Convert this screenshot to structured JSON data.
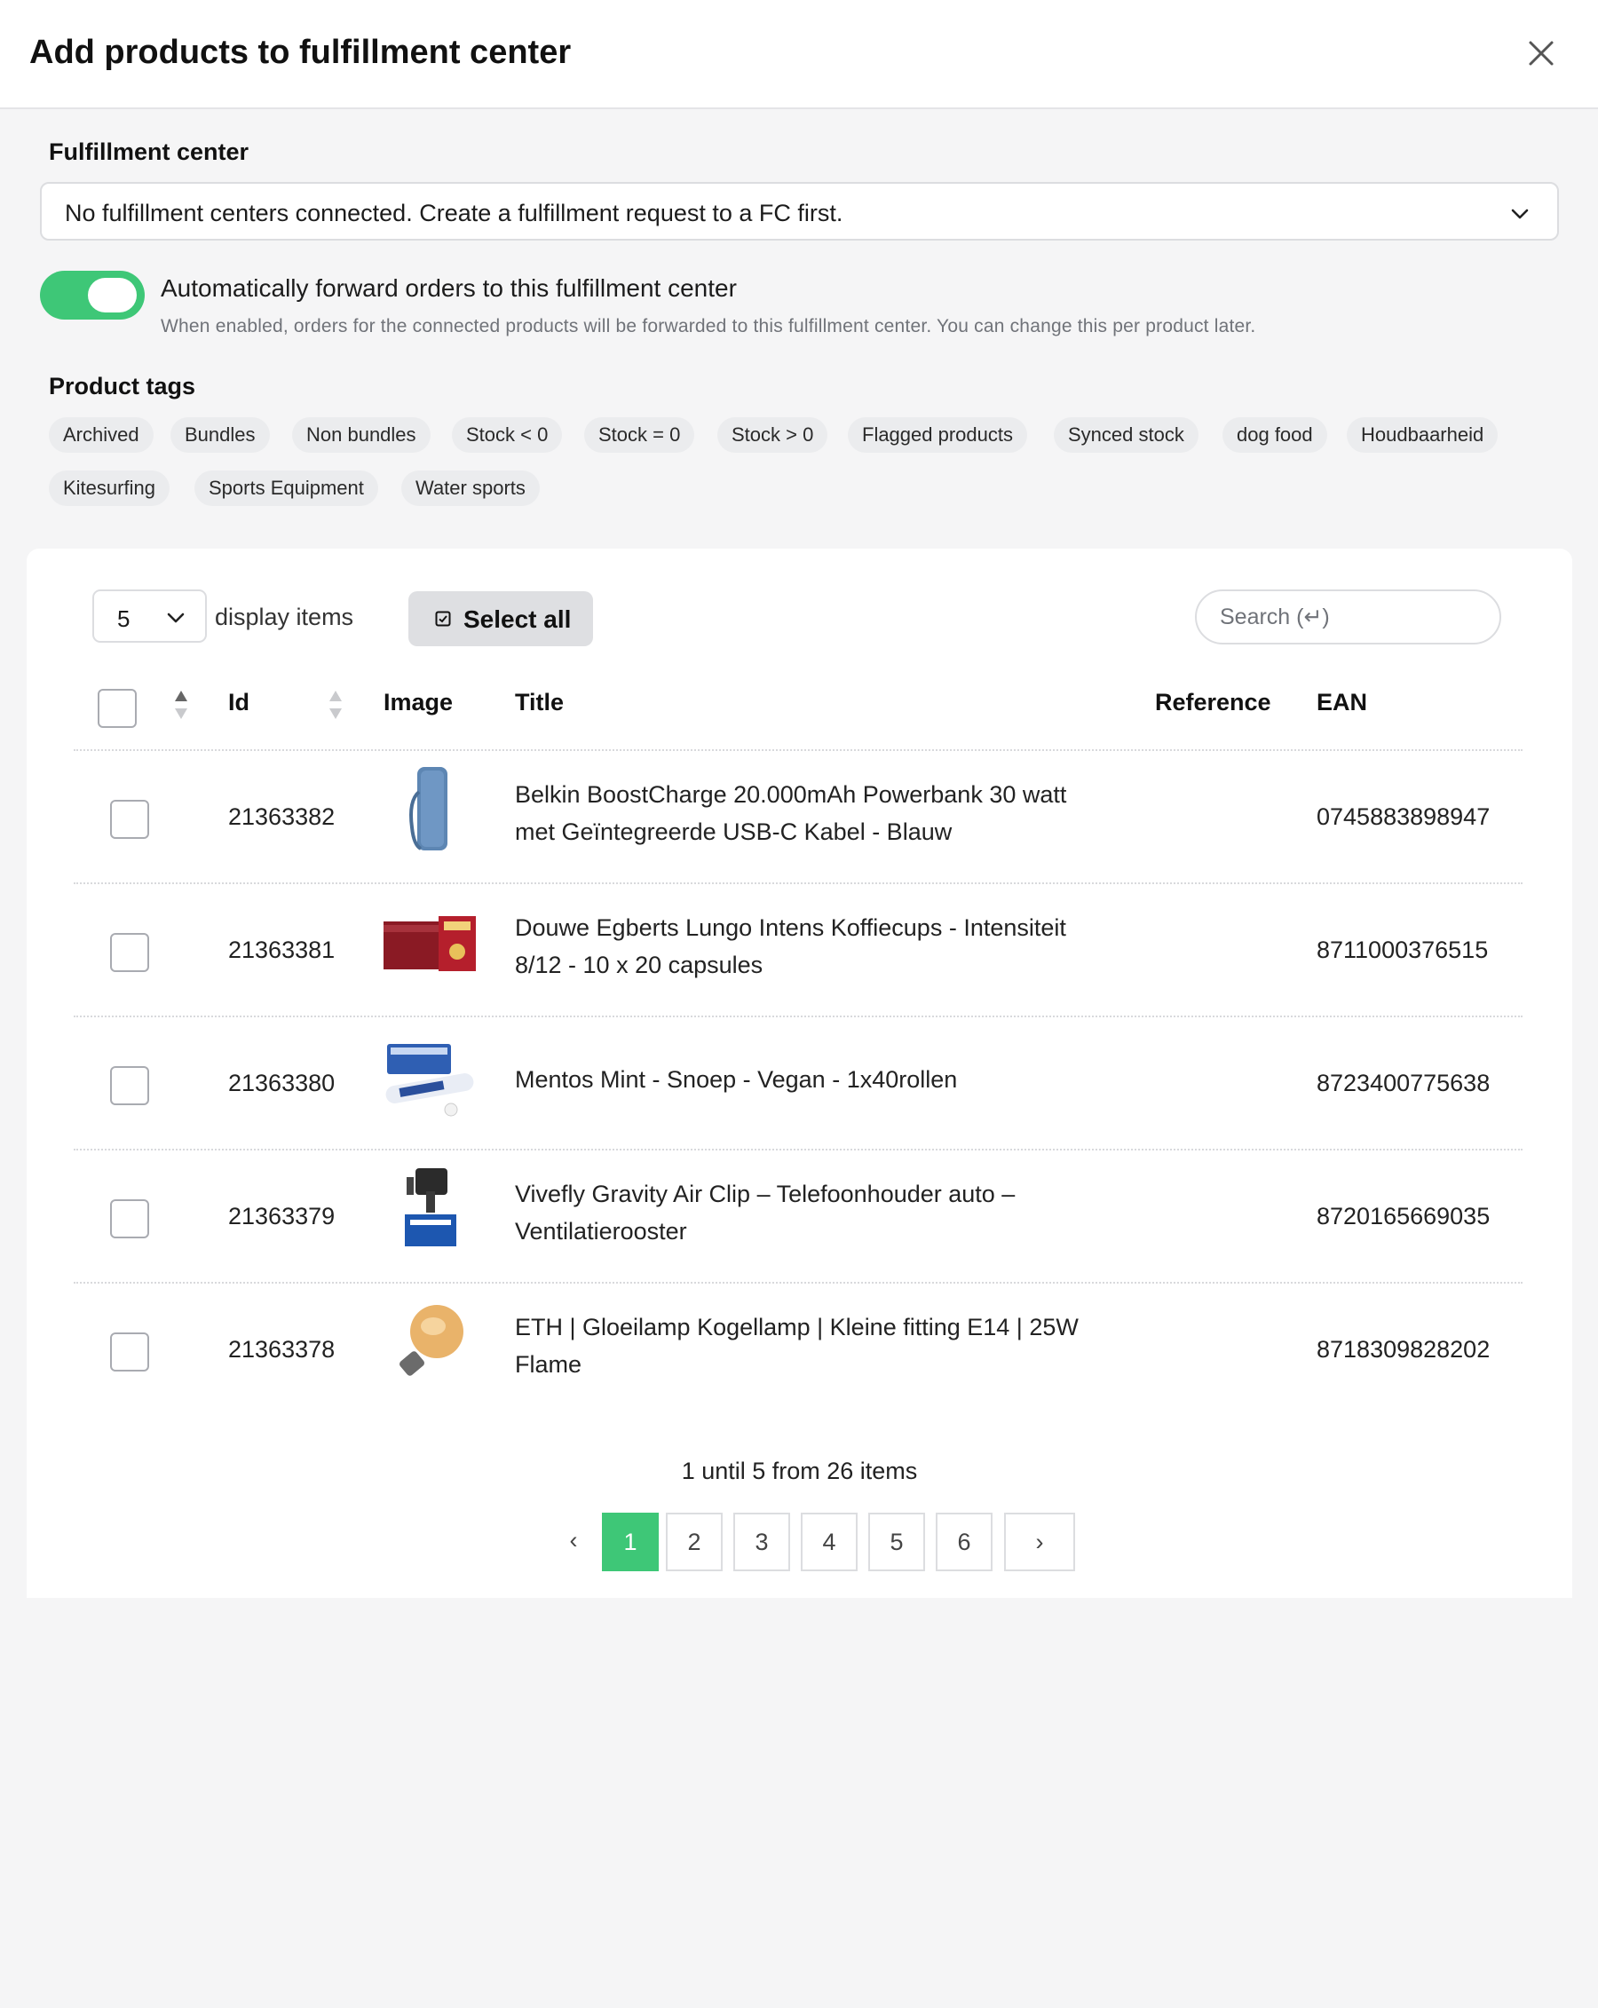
{
  "dialog": {
    "title": "Add products to fulfillment center"
  },
  "fulfillment": {
    "label": "Fulfillment center",
    "selected": "No fulfillment centers connected. Create a fulfillment request to a FC first."
  },
  "forward": {
    "enabled": true,
    "label": "Automatically forward orders to this fulfillment center",
    "help": "When enabled, orders for the connected products will be forwarded to this fulfillment center. You can change this per product later."
  },
  "tags": {
    "label": "Product tags",
    "items": [
      "Archived",
      "Bundles",
      "Non bundles",
      "Stock < 0",
      "Stock = 0",
      "Stock > 0",
      "Flagged products",
      "Synced stock",
      "dog food",
      "Houdbaarheid",
      "Kitesurfing",
      "Sports Equipment",
      "Water sports"
    ]
  },
  "table_controls": {
    "per_page": "5",
    "display_label": "display items",
    "select_all": "Select all",
    "search_placeholder": "Search (↵)"
  },
  "columns": {
    "id": "Id",
    "image": "Image",
    "title": "Title",
    "reference": "Reference",
    "ean": "EAN"
  },
  "rows": [
    {
      "id": "21363382",
      "title_line1": "Belkin BoostCharge 20.000mAh Powerbank 30 watt",
      "title_line2": "met Geïntegreerde USB-C Kabel - Blauw",
      "reference": "",
      "ean": "0745883898947",
      "image": "powerbank"
    },
    {
      "id": "21363381",
      "title_line1": "Douwe Egberts Lungo Intens Koffiecups - Intensiteit",
      "title_line2": "8/12 - 10 x 20 capsules",
      "reference": "",
      "ean": "8711000376515",
      "image": "coffee-boxes"
    },
    {
      "id": "21363380",
      "title_line1": "Mentos Mint - Snoep - Vegan - 1x40rollen",
      "title_line2": "",
      "reference": "",
      "ean": "8723400775638",
      "image": "mentos-pack"
    },
    {
      "id": "21363379",
      "title_line1": "Vivefly Gravity Air Clip – Telefoonhouder auto –",
      "title_line2": "Ventilatierooster",
      "reference": "",
      "ean": "8720165669035",
      "image": "phone-holder"
    },
    {
      "id": "21363378",
      "title_line1": "ETH | Gloeilamp Kogellamp | Kleine fitting E14 | 25W",
      "title_line2": "Flame",
      "reference": "",
      "ean": "8718309828202",
      "image": "light-bulb"
    }
  ],
  "pagination": {
    "summary": "1 until 5 from 26 items",
    "pages": [
      "1",
      "2",
      "3",
      "4",
      "5",
      "6"
    ],
    "current": "1",
    "prev": "‹",
    "next": "›"
  },
  "colors": {
    "accent": "#3ec777",
    "tag_bg": "#ebecee",
    "border": "#dcdde0"
  }
}
